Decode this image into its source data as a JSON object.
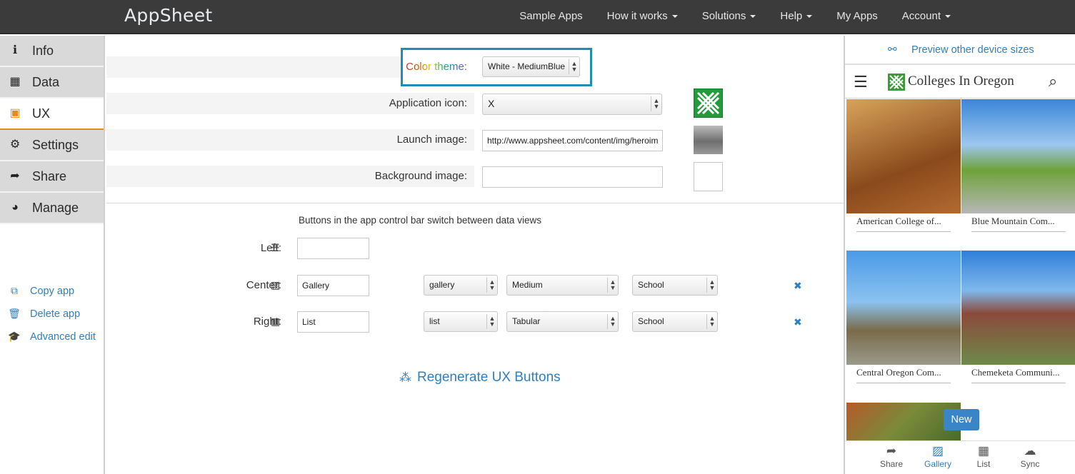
{
  "header": {
    "brand": "AppSheet",
    "nav": [
      {
        "label": "Sample Apps",
        "dropdown": false
      },
      {
        "label": "How it works",
        "dropdown": true
      },
      {
        "label": "Solutions",
        "dropdown": true
      },
      {
        "label": "Help",
        "dropdown": true
      },
      {
        "label": "My Apps",
        "dropdown": false
      },
      {
        "label": "Account",
        "dropdown": true
      }
    ]
  },
  "sidebar": {
    "items": [
      {
        "label": "Info",
        "icon": "info-icon"
      },
      {
        "label": "Data",
        "icon": "table-icon"
      },
      {
        "label": "UX",
        "icon": "image-file-icon",
        "active": true
      },
      {
        "label": "Settings",
        "icon": "gear-icon"
      },
      {
        "label": "Share",
        "icon": "share-arrow-icon"
      },
      {
        "label": "Manage",
        "icon": "dashboard-icon"
      }
    ],
    "links": [
      {
        "label": "Copy app",
        "icon": "copy-icon"
      },
      {
        "label": "Delete app",
        "icon": "trash-icon"
      },
      {
        "label": "Advanced edit",
        "icon": "graduation-cap-icon"
      }
    ]
  },
  "settings": {
    "color_theme": {
      "label": "Color theme:",
      "value": "White - MediumBlue"
    },
    "app_icon": {
      "label": "Application icon:",
      "value": "X"
    },
    "launch_image": {
      "label": "Launch image:",
      "value": "http://www.appsheet.com/content/img/heroim"
    },
    "background_image": {
      "label": "Background image:",
      "value": ""
    }
  },
  "buttons": {
    "caption": "Buttons in the app control bar switch between data views",
    "left": {
      "label": "Left:",
      "name": ""
    },
    "center": {
      "label": "Center:",
      "name": "Gallery",
      "view": "gallery",
      "size": "Medium",
      "table": "School"
    },
    "right": {
      "label": "Right:",
      "name": "List",
      "view": "list",
      "size": "Tabular",
      "table": "School"
    },
    "regenerate": "Regenerate UX Buttons"
  },
  "preview": {
    "link": "Preview other device sizes",
    "app_title": "Colleges In Oregon",
    "cards": [
      {
        "caption": "American College of..."
      },
      {
        "caption": "Blue Mountain Com..."
      },
      {
        "caption": "Central Oregon Com..."
      },
      {
        "caption": "Chemeketa Communi..."
      }
    ],
    "new_button": "New",
    "tabs": [
      {
        "label": "Share",
        "icon": "share-icon"
      },
      {
        "label": "Gallery",
        "icon": "gallery-icon",
        "active": true
      },
      {
        "label": "List",
        "icon": "list-grid-icon"
      },
      {
        "label": "Sync",
        "icon": "cloud-icon"
      }
    ]
  },
  "colors": {
    "accent": "#2f7fc1",
    "highlight": "#1d8db5",
    "topbar": "#3b3b3b",
    "active_tab": "#e88a1a"
  }
}
